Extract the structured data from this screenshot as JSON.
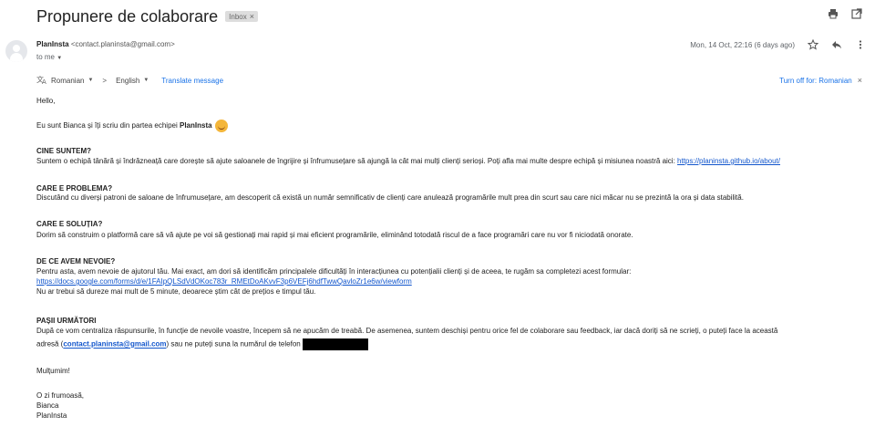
{
  "header": {
    "subject": "Propunere de colaborare",
    "label_chip": "Inbox",
    "label_chip_close": "×"
  },
  "sender": {
    "name": "PlanInsta",
    "email": "<contact.planinsta@gmail.com>",
    "to": "to me",
    "date": "Mon, 14 Oct, 22:16 (6 days ago)"
  },
  "translate": {
    "from_lang": "Romanian",
    "arrow": ">",
    "to_lang": "English",
    "action": "Translate message",
    "turn_off": "Turn off for: Romanian",
    "close": "×"
  },
  "message": {
    "greeting": "Hello,",
    "intro_pre": "Eu sunt Bianca și îți scriu din partea echipei ",
    "intro_brand": "PlanInsta",
    "s1_title": "CINE SUNTEM?",
    "s1_text": "Suntem o echipă tânără și îndrăzneață care dorește să ajute saloanele de îngrijire și înfrumusețare să ajungă la cât mai mulți clienți serioși. Poți afla mai multe despre echipă și misiunea noastră aici:  ",
    "s1_link": "https://planinsta.github.io/about/",
    "s2_title": "CARE E PROBLEMA?",
    "s2_text": "Discutând cu diverși patroni de saloane de înfrumusețare, am descoperit că există un număr semnificativ de clienți care anulează programările mult prea din scurt sau care nici măcar nu se prezintă la ora și data stabilită.",
    "s3_title": "CARE E SOLUȚIA?",
    "s3_text": "Dorim să construim o platformă care să vă ajute pe voi să gestionați mai rapid și mai eficient programările, eliminând totodată riscul de a face programări care nu vor fi niciodată onorate.",
    "s4_title": "DE CE AVEM NEVOIE?",
    "s4_text1": "Pentru asta, avem nevoie de ajutorul tău. Mai exact, am dori să identificăm principalele dificultăți în interacțiunea cu potențialii clienți și de aceea, te rugăm sa completezi acest formular:",
    "s4_link": "https://docs.google.com/forms/d/e/1FAIpQLSdVdOKoc783r_RMEtDoAKvvF3p6VEFj6hdfTwwQavloZr1e6w/viewform",
    "s4_text2": "Nu ar trebui să dureze mai mult de 5 minute, deoarece știm cât de prețios e timpul tău.",
    "s5_title": "PAȘII URMĂTORI",
    "s5_text1": "După ce vom centraliza răspunsurile, în funcție de nevoile voastre, începem să ne apucăm de treabă. De asemenea, suntem deschiși pentru orice fel de colaborare sau feedback, iar dacă doriți să ne scrieți, o puteți face la această",
    "s5_text2a": "adresă (",
    "s5_email": "contact.planinsta@gmail.com",
    "s5_text2b": ") sau ne puteți suna la numărul de telefon ",
    "thanks": "Mulțumim!",
    "closing": "O zi frumoasă,",
    "sign_name": "Bianca",
    "sign_team": "PlanInsta"
  },
  "colors": {
    "link": "#1155cc",
    "accent": "#1a73e8",
    "text": "#222222"
  }
}
